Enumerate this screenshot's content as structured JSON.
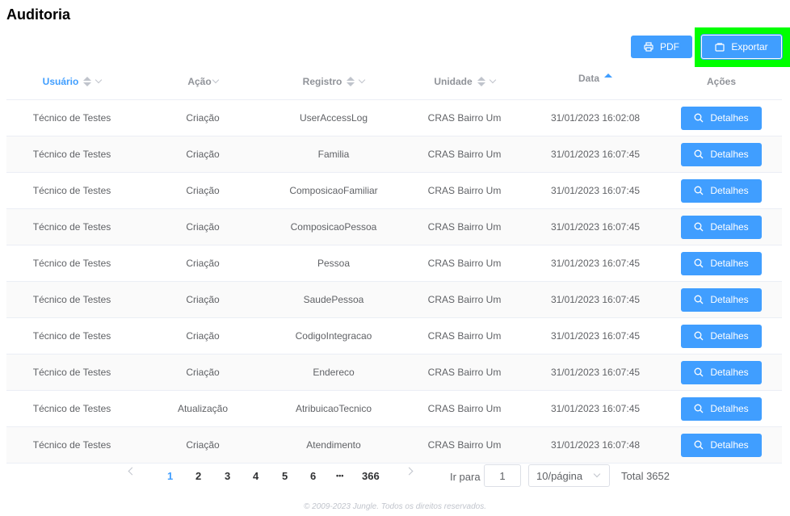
{
  "page": {
    "title": "Auditoria"
  },
  "toolbar": {
    "pdf_label": "PDF",
    "export_label": "Exportar"
  },
  "table": {
    "headers": {
      "usuario": "Usuário",
      "acao": "Ação",
      "registro": "Registro",
      "unidade": "Unidade",
      "data": "Data",
      "acoes": "Ações"
    },
    "details_label": "Detalhes",
    "rows": [
      {
        "usuario": "Técnico de Testes",
        "acao": "Criação",
        "registro": "UserAccessLog",
        "unidade": "CRAS Bairro Um",
        "data": "31/01/2023 16:02:08"
      },
      {
        "usuario": "Técnico de Testes",
        "acao": "Criação",
        "registro": "Familia",
        "unidade": "CRAS Bairro Um",
        "data": "31/01/2023 16:07:45"
      },
      {
        "usuario": "Técnico de Testes",
        "acao": "Criação",
        "registro": "ComposicaoFamiliar",
        "unidade": "CRAS Bairro Um",
        "data": "31/01/2023 16:07:45"
      },
      {
        "usuario": "Técnico de Testes",
        "acao": "Criação",
        "registro": "ComposicaoPessoa",
        "unidade": "CRAS Bairro Um",
        "data": "31/01/2023 16:07:45"
      },
      {
        "usuario": "Técnico de Testes",
        "acao": "Criação",
        "registro": "Pessoa",
        "unidade": "CRAS Bairro Um",
        "data": "31/01/2023 16:07:45"
      },
      {
        "usuario": "Técnico de Testes",
        "acao": "Criação",
        "registro": "SaudePessoa",
        "unidade": "CRAS Bairro Um",
        "data": "31/01/2023 16:07:45"
      },
      {
        "usuario": "Técnico de Testes",
        "acao": "Criação",
        "registro": "CodigoIntegracao",
        "unidade": "CRAS Bairro Um",
        "data": "31/01/2023 16:07:45"
      },
      {
        "usuario": "Técnico de Testes",
        "acao": "Criação",
        "registro": "Endereco",
        "unidade": "CRAS Bairro Um",
        "data": "31/01/2023 16:07:45"
      },
      {
        "usuario": "Técnico de Testes",
        "acao": "Atualização",
        "registro": "AtribuicaoTecnico",
        "unidade": "CRAS Bairro Um",
        "data": "31/01/2023 16:07:45"
      },
      {
        "usuario": "Técnico de Testes",
        "acao": "Criação",
        "registro": "Atendimento",
        "unidade": "CRAS Bairro Um",
        "data": "31/01/2023 16:07:48"
      }
    ]
  },
  "pagination": {
    "pages": [
      "1",
      "2",
      "3",
      "4",
      "5",
      "6"
    ],
    "ellipsis": "•••",
    "last_page": "366",
    "current_page": "1",
    "goto_label": "Ir para",
    "goto_value": "1",
    "page_size": "10/página",
    "total": "Total 3652"
  },
  "footer": {
    "text": "© 2009-2023 Jungle. Todos os direitos reservados."
  },
  "colors": {
    "primary": "#409eff",
    "highlight": "#00ff00"
  },
  "icons": {
    "pdf": "printer-icon",
    "export": "window-icon",
    "details": "search-icon"
  }
}
